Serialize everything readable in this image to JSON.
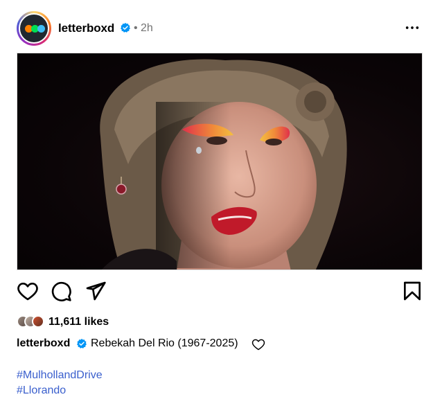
{
  "post": {
    "username": "letterboxd",
    "separator": "•",
    "time_ago": "2h",
    "likes": "11,611 likes",
    "caption_user": "letterboxd",
    "caption_text": "Rebekah Del Rio (1967-2025)",
    "hashtags": [
      "#MulhollandDrive",
      "#Llorando"
    ]
  },
  "colors": {
    "verified": "#0095f6",
    "hashtag": "#3a5fcd",
    "brand_orange": "#ff8000",
    "brand_green": "#00e054",
    "brand_blue": "#40bcf4"
  },
  "icons": {
    "like": "heart-icon",
    "comment": "comment-icon",
    "share": "paper-plane-icon",
    "save": "bookmark-icon",
    "more": "more-horizontal-icon"
  }
}
